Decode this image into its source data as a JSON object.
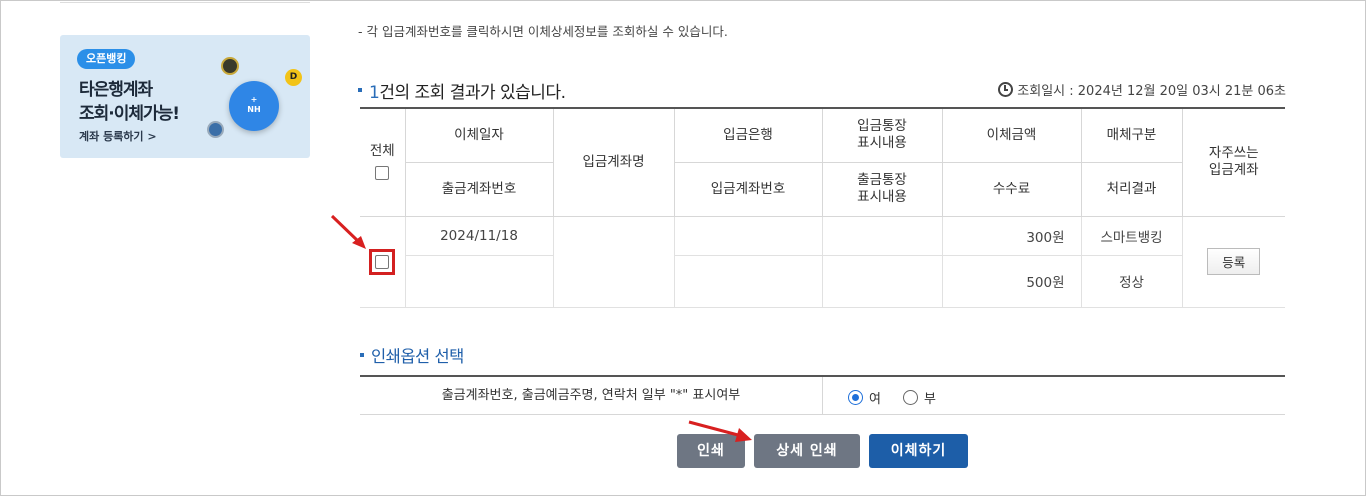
{
  "notice_text": "- 각 입금계좌번호를 클릭하시면 이체상세정보를 조회하실 수 있습니다.",
  "promo": {
    "badge": "오픈뱅킹",
    "line1": "타은행계좌",
    "line2": "조회·이체가능!",
    "link": "계좌 등록하기 >",
    "circle_label": "+\nNH",
    "coin_letter": "D"
  },
  "result": {
    "count": "1",
    "title_suffix": "건의 조회 결과가 있습니다.",
    "query_time": "조회일시 : 2024년 12월 20일 03시 21분 06초"
  },
  "table": {
    "headers": {
      "select_all": "전체",
      "transfer_date": "이체일자",
      "deposit_account_name": "입금계좌명",
      "deposit_bank": "입금은행",
      "deposit_memo": "입금통장\n표시내용",
      "transfer_amount": "이체금액",
      "media_type": "매체구분",
      "frequent_account": "자주쓰는\n입금계좌",
      "withdraw_account_no": "출금계좌번호",
      "deposit_account_no": "입금계좌번호",
      "withdraw_memo": "출금통장\n표시내용",
      "fee": "수수료",
      "result": "처리결과"
    },
    "row": {
      "transfer_date": "2024/11/18",
      "withdraw_account_no": "",
      "deposit_account_name": "",
      "deposit_bank": "",
      "deposit_account_no": "",
      "deposit_memo": "",
      "withdraw_memo": "",
      "transfer_amount": "300원",
      "fee": "500원",
      "media_type": "스마트뱅킹",
      "result": "정상",
      "register_label": "등록"
    }
  },
  "print_options": {
    "title": "인쇄옵션 선택",
    "option_label": "출금계좌번호, 출금예금주명, 연락처 일부 \"*\" 표시여부",
    "yes_label": "여",
    "no_label": "부",
    "selected": "여"
  },
  "buttons": {
    "print": "인쇄",
    "detail_print": "상세 인쇄",
    "transfer": "이체하기"
  },
  "colors": {
    "accent_blue": "#1d5ea8",
    "highlight_red": "#d32020",
    "gray_button": "#6e7683"
  }
}
